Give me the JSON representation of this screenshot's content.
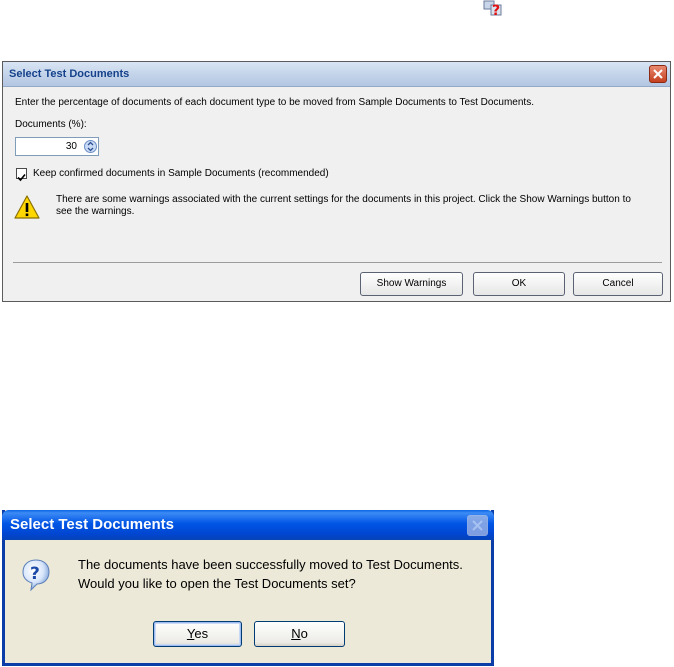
{
  "help": {
    "icon": "help-question-icon"
  },
  "dialog1": {
    "title": "Select Test Documents",
    "instruction": "Enter the percentage of documents of each document type to be moved from Sample Documents to Test Documents.",
    "documents_label": "Documents (%):",
    "documents_value": "30",
    "keep_checkbox_label": "Keep confirmed documents in Sample Documents (recommended)",
    "keep_checked": true,
    "warning_line1": "There are some warnings associated with the current settings for the documents in this project. Click the Show Warnings button to",
    "warning_line2": "see the warnings.",
    "buttons": {
      "show_warnings": "Show Warnings",
      "ok": "OK",
      "cancel": "Cancel"
    }
  },
  "dialog2": {
    "title": "Select Test Documents",
    "message_line1": "The documents have been successfully moved to Test Documents.",
    "message_line2": "Would you like to open the Test Documents set?",
    "buttons": {
      "yes_underlined": "Y",
      "yes_rest": "es",
      "no_underlined": "N",
      "no_rest": "o"
    }
  },
  "colors": {
    "xp_title_blue": "#0055e5",
    "xp_dialog_bg": "#ece9d8",
    "close_red": "#c5401f",
    "warning_yellow": "#ffd700"
  }
}
